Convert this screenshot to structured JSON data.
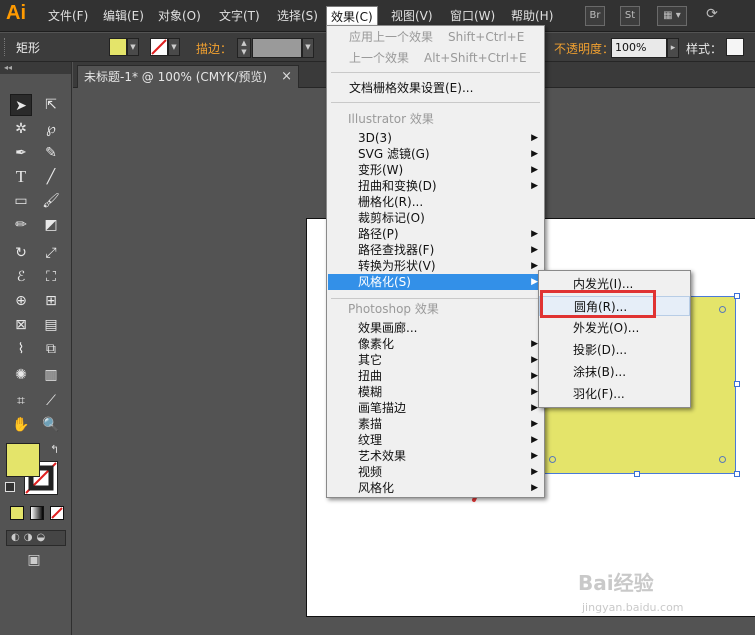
{
  "app": {
    "logo": "Ai"
  },
  "menubar": {
    "items": [
      "文件(F)",
      "编辑(E)",
      "对象(O)",
      "文字(T)",
      "选择(S)",
      "效果(C)",
      "视图(V)",
      "窗口(W)",
      "帮助(H)"
    ],
    "active": "效果(C)",
    "bridge_button": "Br",
    "stock_button": "St"
  },
  "controlbar": {
    "tool_name": "矩形",
    "fill_color": "#e4e46a",
    "stroke_label": "描边：",
    "opacity_label": "不透明度：",
    "opacity_value": "100%",
    "style_label": "样式："
  },
  "document": {
    "tab_title": "未标题-1* @ 100% (CMYK/预览)",
    "close_glyph": "×"
  },
  "effect_menu": {
    "apply_last": "应用上一个效果",
    "apply_last_shortcut": "Shift+Ctrl+E",
    "last_effect": "上一个效果",
    "last_effect_shortcut": "Alt+Shift+Ctrl+E",
    "raster_settings": "文档栅格效果设置(E)...",
    "illustrator_header": "Illustrator 效果",
    "illustrator_items": [
      {
        "label": "3D(3)",
        "submenu": true
      },
      {
        "label": "SVG 滤镜(G)",
        "submenu": true
      },
      {
        "label": "变形(W)",
        "submenu": true
      },
      {
        "label": "扭曲和变换(D)",
        "submenu": true
      },
      {
        "label": "栅格化(R)...",
        "submenu": false
      },
      {
        "label": "裁剪标记(O)",
        "submenu": false
      },
      {
        "label": "路径(P)",
        "submenu": true
      },
      {
        "label": "路径查找器(F)",
        "submenu": true
      },
      {
        "label": "转换为形状(V)",
        "submenu": true
      },
      {
        "label": "风格化(S)",
        "submenu": true
      }
    ],
    "highlighted": "风格化(S)",
    "photoshop_header": "Photoshop 效果",
    "photoshop_items": [
      {
        "label": "效果画廊...",
        "submenu": false
      },
      {
        "label": "像素化",
        "submenu": true
      },
      {
        "label": "其它",
        "submenu": true
      },
      {
        "label": "扭曲",
        "submenu": true
      },
      {
        "label": "模糊",
        "submenu": true
      },
      {
        "label": "画笔描边",
        "submenu": true
      },
      {
        "label": "素描",
        "submenu": true
      },
      {
        "label": "纹理",
        "submenu": true
      },
      {
        "label": "艺术效果",
        "submenu": true
      },
      {
        "label": "视频",
        "submenu": true
      },
      {
        "label": "风格化",
        "submenu": true
      }
    ]
  },
  "stylize_submenu": {
    "items": [
      "内发光(I)...",
      "圆角(R)...",
      "外发光(O)...",
      "投影(D)...",
      "涂抹(B)...",
      "羽化(F)..."
    ],
    "hovered": "圆角(R)..."
  },
  "tools_panel": {
    "fill_color": "#e4e46a"
  },
  "watermark": {
    "brand": "Bai经验",
    "url": "jingyan.baidu.com"
  }
}
